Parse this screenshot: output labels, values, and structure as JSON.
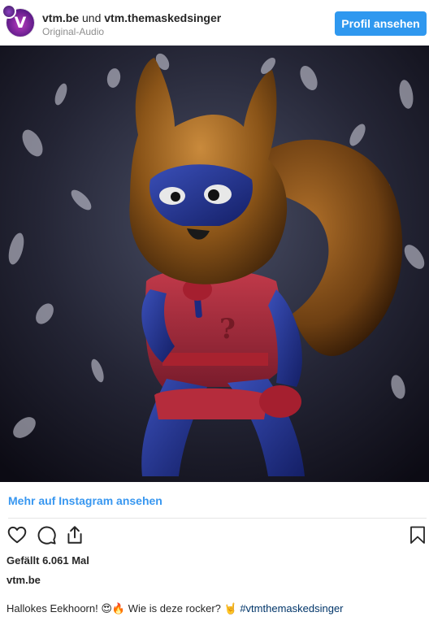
{
  "header": {
    "user1": "vtm.be",
    "connector": "und",
    "user2": "vtm.themaskedsinger",
    "audio": "Original-Audio",
    "profile_button": "Profil ansehen"
  },
  "media": {
    "alt_icon": "photo"
  },
  "more_link": "Mehr auf Instagram ansehen",
  "actions": {
    "like_icon": "heart-icon",
    "comment_icon": "comment-icon",
    "share_icon": "share-icon",
    "save_icon": "bookmark-icon"
  },
  "likes": "Gefällt 6.061 Mal",
  "owner": "vtm.be",
  "caption": {
    "text_a": "Hallokes Eekhoorn!",
    "emoji_a": "😍",
    "emoji_b": "🔥",
    "text_b": "Wie is deze rocker?",
    "emoji_c": "🤘",
    "hashtag": "#vtmthemaskedsinger"
  },
  "colors": {
    "button_blue": "#2f98ef",
    "link_blue": "#3897f0",
    "text": "#262626",
    "muted": "#8e8e8e"
  }
}
